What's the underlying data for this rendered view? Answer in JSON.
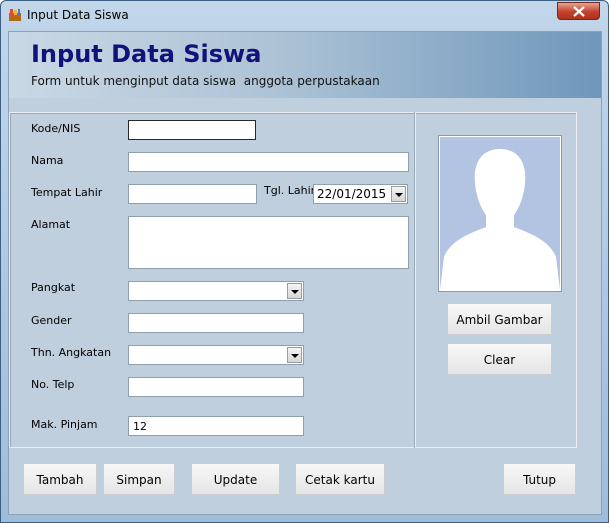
{
  "window": {
    "title": "Input Data Siswa"
  },
  "header": {
    "title": "Input Data Siswa",
    "subtitle": "Form untuk menginput data siswa  anggota perpustakaan"
  },
  "form": {
    "kode_label": "Kode/NIS",
    "kode_value": "",
    "nama_label": "Nama",
    "nama_value": "",
    "tempat_label": "Tempat Lahir",
    "tempat_value": "",
    "tgl_label": "Tgl. Lahir",
    "tgl_value": "22/01/2015",
    "alamat_label": "Alamat",
    "alamat_value": "",
    "pangkat_label": "Pangkat",
    "pangkat_value": "",
    "gender_label": "Gender",
    "gender_value": "",
    "angkatan_label": "Thn. Angkatan",
    "angkatan_value": "",
    "telp_label": "No. Telp",
    "telp_value": "",
    "pinjam_label": "Mak. Pinjam",
    "pinjam_value": "12"
  },
  "photo": {
    "icon": "user-silhouette-icon"
  },
  "buttons": {
    "ambil": "Ambil Gambar",
    "clear": "Clear",
    "tambah": "Tambah",
    "simpan": "Simpan",
    "update": "Update",
    "cetak": "Cetak kartu",
    "tutup": "Tutup"
  },
  "colors": {
    "title_text": "#13127a",
    "window_frame": "#9fbcd9",
    "form_bg": "#bfcfdd",
    "close_button": "#c4412b"
  }
}
